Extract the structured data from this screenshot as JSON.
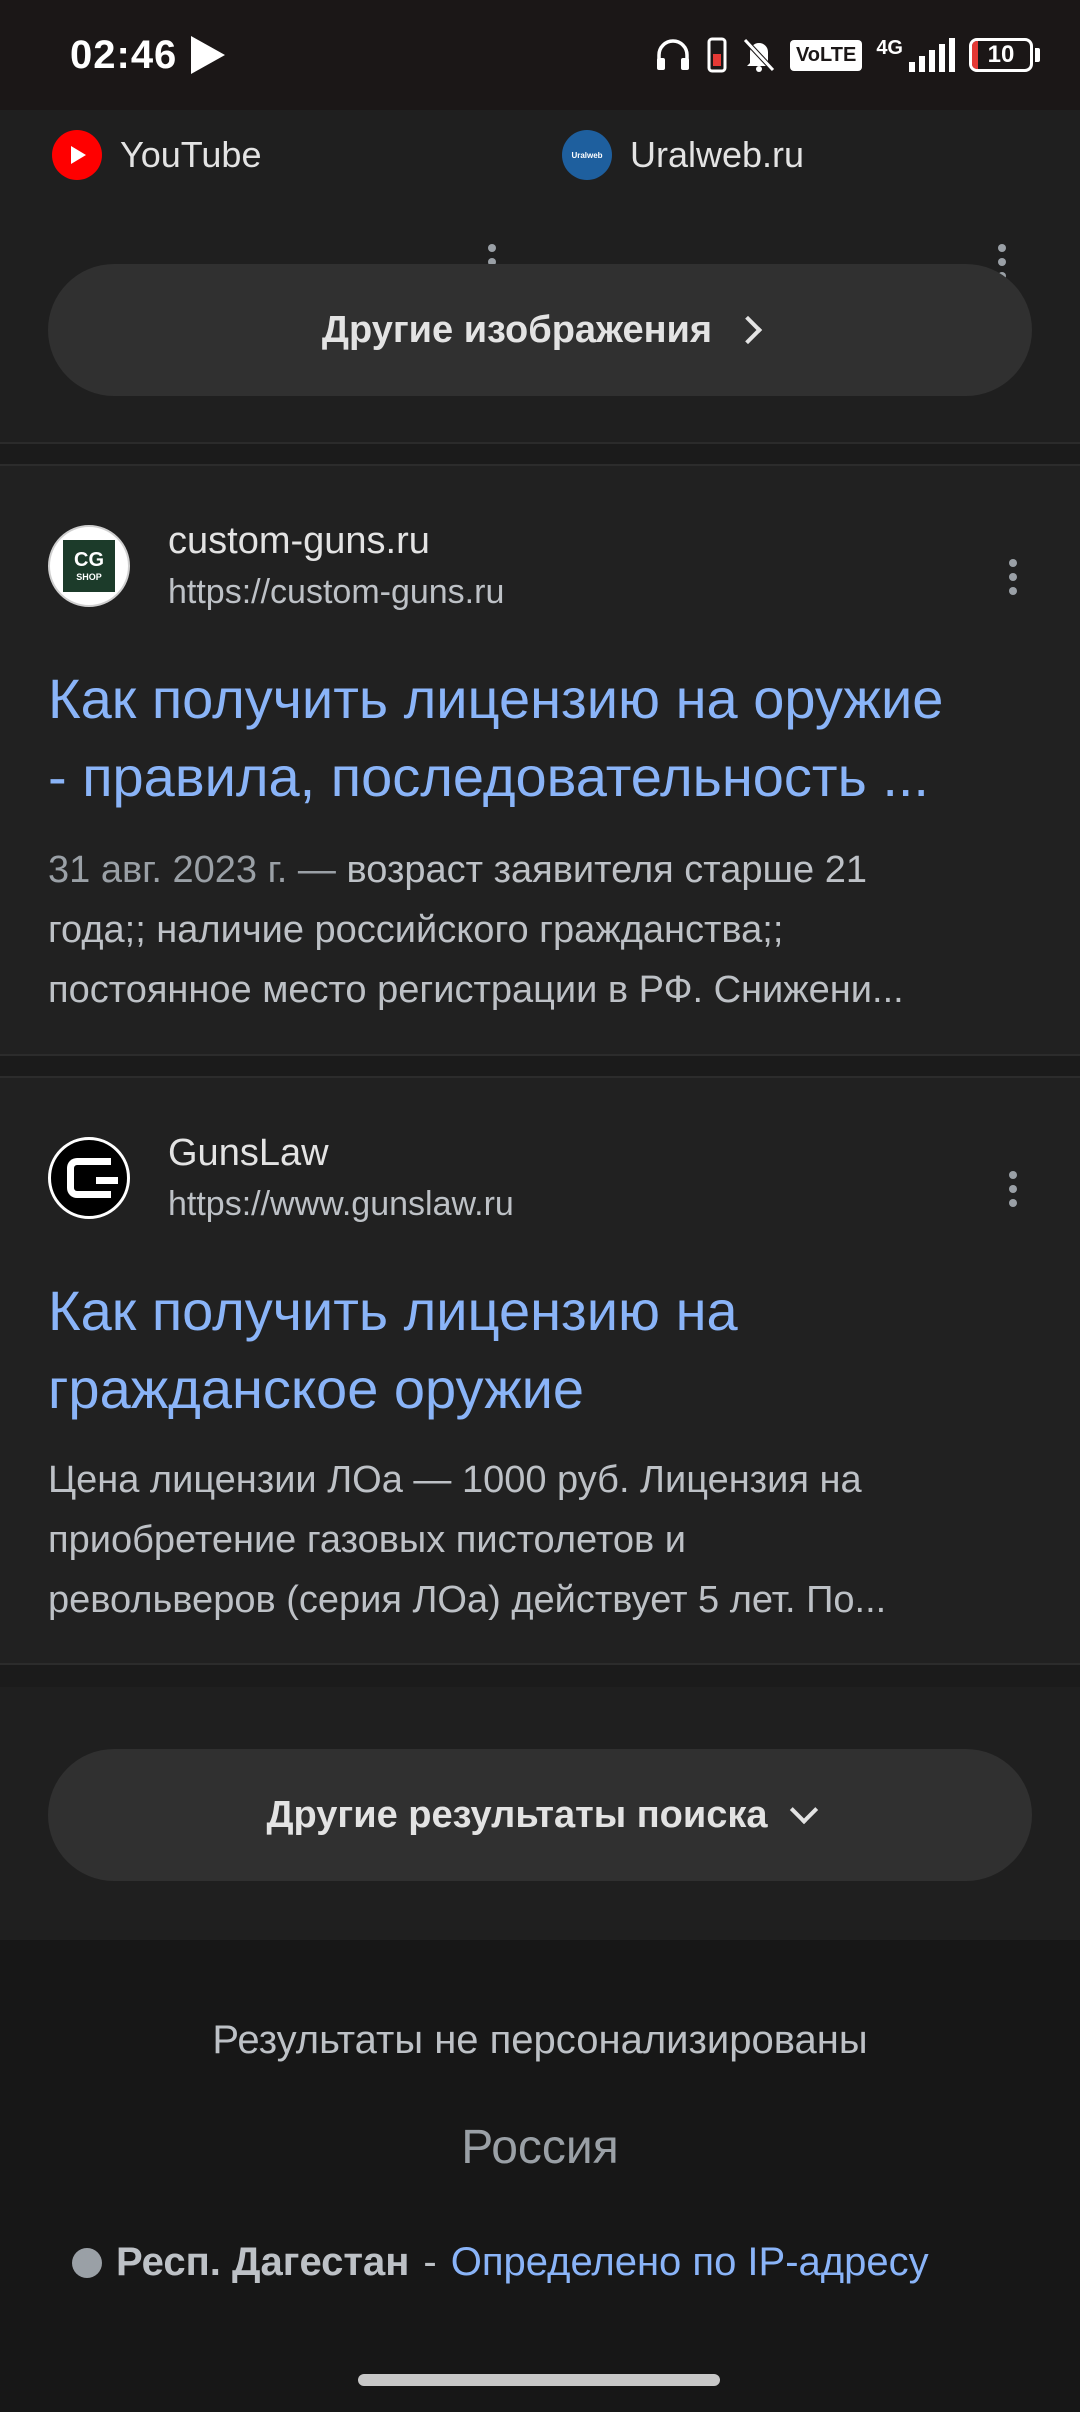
{
  "status_bar": {
    "time": "02:46",
    "volte": "VoLTE",
    "network": "4G",
    "battery": "10",
    "battery_level": 0.1,
    "icons": [
      "play-icon",
      "headphones-icon",
      "vibrate-icon",
      "mute-icon",
      "volte-icon",
      "signal-icon",
      "battery-icon"
    ]
  },
  "sources": [
    {
      "name": "YouTube",
      "icon": "youtube-icon"
    },
    {
      "name": "Uralweb.ru",
      "icon": "uralweb-icon",
      "logo_text": "Uralweb"
    }
  ],
  "more_images_label": "Другие изображения",
  "results": [
    {
      "site_name": "custom-guns.ru",
      "url": "https://custom-guns.ru",
      "favicon_text": "CG",
      "favicon_subtext": "SHOP",
      "title_lines": [
        "Как получить лицензию на оружие",
        "- правила, последовательность ..."
      ],
      "date": "31 авг. 2023 г. —",
      "snippet_lines": [
        " возраст заявителя старше 21",
        "года;; наличие российского гражданства;;",
        "постоянное место регистрации в РФ. Снижени..."
      ]
    },
    {
      "site_name": "GunsLaw",
      "url": "https://www.gunslaw.ru",
      "title_lines": [
        "Как получить лицензию на",
        "гражданское оружие"
      ],
      "snippet_lines": [
        "Цена лицензии ЛОа — 1000 руб. Лицензия на",
        "приобретение газовых пистолетов и",
        "револьверов (серия ЛОа) действует 5 лет. По..."
      ]
    }
  ],
  "more_results_label": "Другие результаты поиска",
  "footer": {
    "note": "Результаты не персонализированы",
    "country": "Россия",
    "region": "Респ. Дагестан",
    "separator": "-",
    "ip_link": "Определено по IP-адресу"
  },
  "colors": {
    "link": "#8ab4f8",
    "background": "#1f1f1f",
    "card": "#212121",
    "pill": "#303030",
    "youtube_red": "#ff0000",
    "battery_red": "#e53935"
  }
}
